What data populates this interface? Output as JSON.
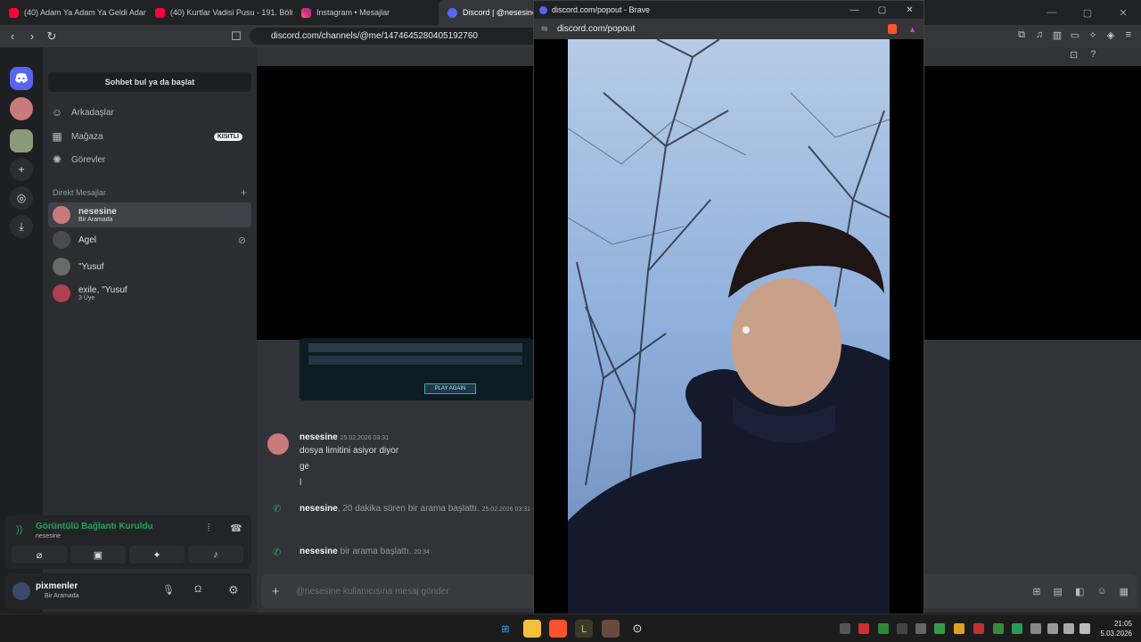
{
  "browser": {
    "tabs": [
      {
        "label": "(40) Adam Ya Adam Ya Geldi Adam",
        "color": "#ff0033"
      },
      {
        "label": "(40) Kurtlar Vadisi Pusu - 191. Bölüm",
        "color": "#ff0033"
      },
      {
        "label": "Instagram • Mesajlar",
        "color": "#e1306c"
      },
      {
        "label": "Discord | @nesesine",
        "color": "#5865f2"
      }
    ],
    "url": "discord.com/channels/@me/1474645280405192760"
  },
  "popout": {
    "title": "discord.com/popout - Brave",
    "url": "discord.com/popout"
  },
  "discord": {
    "search": "Sohbet bul ya da başlat",
    "nav": [
      {
        "label": "Arkadaşlar",
        "icon": "friends-icon"
      },
      {
        "label": "Mağaza",
        "icon": "shop-icon",
        "badge": "KISITLI"
      },
      {
        "label": "Görevler",
        "icon": "quests-icon"
      }
    ],
    "dm_header": "Direkt Mesajlar",
    "dms": [
      {
        "name": "nesesine",
        "sub": "Bir Aramada"
      },
      {
        "name": "Agel",
        "sub": ""
      },
      {
        "name": "\"Yusuf",
        "sub": ""
      },
      {
        "name": "exile, \"Yusuf",
        "sub": "3 Üye"
      }
    ],
    "voice": {
      "status": "Görüntülü Bağlantı Kuruldu",
      "channel": "nesesine"
    },
    "user": {
      "name": "pixmenler",
      "status": "Bir Aramada"
    },
    "messages": {
      "author": "nesesine",
      "timestamp": "25.02.2026 03:31",
      "lines": [
        "dosya limitini asiyor diyor",
        "ge",
        "l"
      ]
    },
    "calls": [
      {
        "author": "nesesine",
        "text": ", 20 dakika süren bir arama başlattı.",
        "ts": "25.02.2026 03:31"
      },
      {
        "author": "nesesine",
        "text": " bir arama başlattı.",
        "ts": "20:34"
      }
    ],
    "composer_placeholder": "@nesesine kullanıcısına mesaj gönder",
    "thumb_button": "PLAY AGAIN"
  },
  "taskbar": {
    "time": "21:05",
    "date": "5.03.2026"
  }
}
